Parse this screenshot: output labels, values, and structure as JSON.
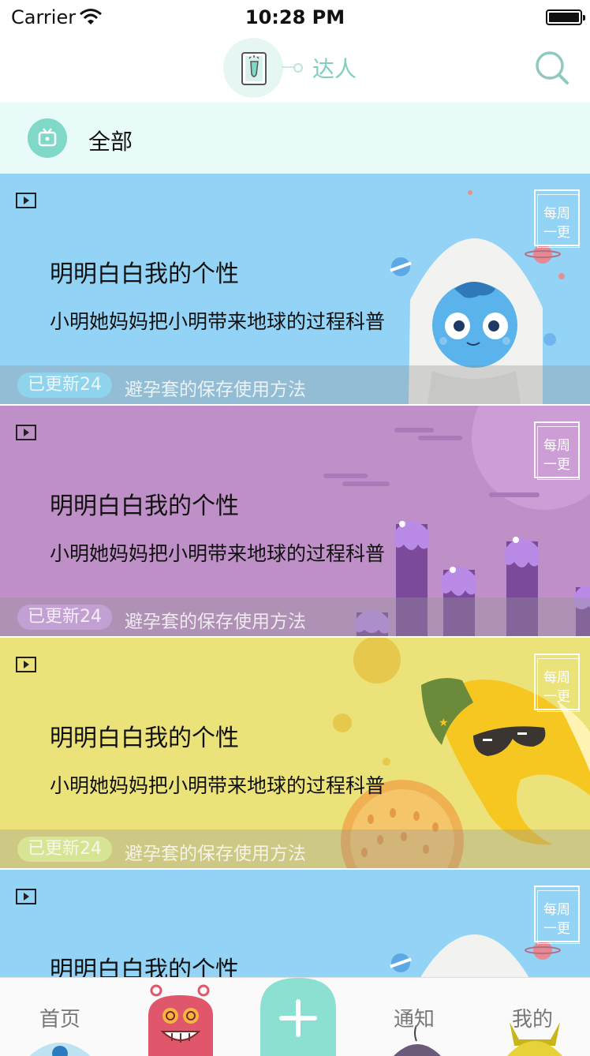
{
  "status_bar": {
    "carrier": "Carrier",
    "time": "10:28 PM"
  },
  "nav_bar": {
    "title": "达人"
  },
  "category": {
    "label": "全部"
  },
  "cards": [
    {
      "title": "明明白白我的个性",
      "subtitle": "小明她妈妈把小明带来地球的过程科普",
      "badge_line1": "每周",
      "badge_line2": "一更",
      "update_label": "已更新24",
      "footer_text": "避孕套的保存使用方法",
      "theme": "blue",
      "color": "#93d3f6"
    },
    {
      "title": "明明白白我的个性",
      "subtitle": "小明她妈妈把小明带来地球的过程科普",
      "badge_line1": "每周",
      "badge_line2": "一更",
      "update_label": "已更新24",
      "footer_text": "避孕套的保存使用方法",
      "theme": "purple",
      "color": "#bf8fc8"
    },
    {
      "title": "明明白白我的个性",
      "subtitle": "小明她妈妈把小明带来地球的过程科普",
      "badge_line1": "每周",
      "badge_line2": "一更",
      "update_label": "已更新24",
      "footer_text": "避孕套的保存使用方法",
      "theme": "yellow",
      "color": "#ebe37a"
    },
    {
      "title": "明明白白我的个性",
      "subtitle": "",
      "badge_line1": "每周",
      "badge_line2": "一更",
      "update_label": "",
      "footer_text": "",
      "theme": "blue",
      "color": "#93d3f6"
    }
  ],
  "tab_bar": {
    "home_label": "首页",
    "notify_label": "通知",
    "mine_label": "我的"
  },
  "colors": {
    "accent": "#7fcfbf",
    "category_bg": "#e9fbf8",
    "add_button": "#8be0d2"
  }
}
